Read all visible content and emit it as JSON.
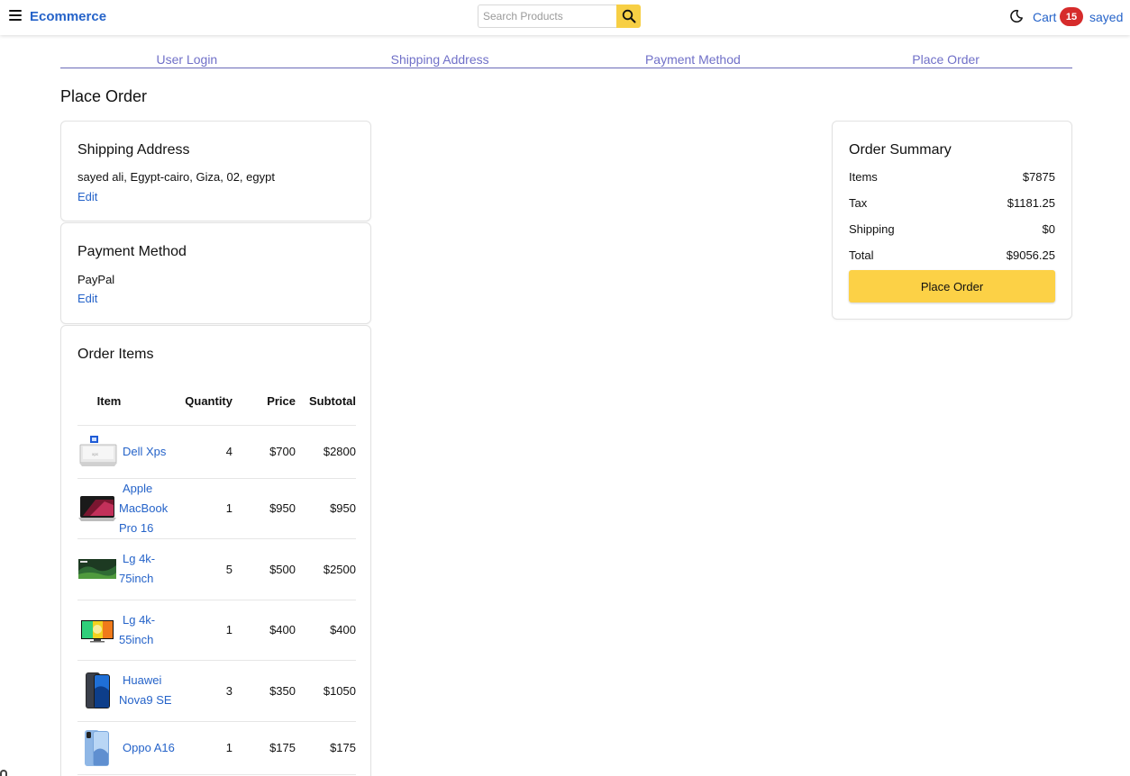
{
  "header": {
    "brand": "Ecommerce",
    "search_placeholder": "Search Products",
    "cart_label": "Cart",
    "cart_count": "15",
    "user_name": "sayed"
  },
  "steps": [
    "User Login",
    "Shipping Address",
    "Payment Method",
    "Place Order"
  ],
  "page_title": "Place Order",
  "shipping": {
    "title": "Shipping Address",
    "address": "sayed ali, Egypt-cairo, Giza, 02, egypt",
    "edit_label": "Edit"
  },
  "payment": {
    "title": "Payment Method",
    "method": "PayPal",
    "edit_label": "Edit"
  },
  "order_items": {
    "title": "Order Items",
    "columns": [
      "Item",
      "Quantity",
      "Price",
      "Subtotal"
    ],
    "rows": [
      {
        "name": "Dell Xps",
        "qty": "4",
        "price": "$700",
        "subtotal": "$2800",
        "thumb": "laptop-icon"
      },
      {
        "name": "Apple MacBook Pro 16",
        "qty": "1",
        "price": "$950",
        "subtotal": "$950",
        "thumb": "macbook-icon"
      },
      {
        "name": "Lg 4k-75inch",
        "qty": "5",
        "price": "$500",
        "subtotal": "$2500",
        "thumb": "tv-icon"
      },
      {
        "name": "Lg 4k-55inch",
        "qty": "1",
        "price": "$400",
        "subtotal": "$400",
        "thumb": "tv-icon"
      },
      {
        "name": "Huawei Nova9 SE",
        "qty": "3",
        "price": "$350",
        "subtotal": "$1050",
        "thumb": "phone-icon"
      },
      {
        "name": "Oppo A16",
        "qty": "1",
        "price": "$175",
        "subtotal": "$175",
        "thumb": "phone-icon"
      }
    ]
  },
  "summary": {
    "title": "Order Summary",
    "items_label": "Items",
    "items_value": "$7875",
    "tax_label": "Tax",
    "tax_value": "$1181.25",
    "shipping_label": "Shipping",
    "shipping_value": "$0",
    "total_label": "Total",
    "total_value": "$9056.25",
    "button_label": "Place Order"
  },
  "colors": {
    "brand": "#2563c9",
    "accent": "#fcd146",
    "badge": "#d62b2b",
    "step": "#7070c8"
  }
}
